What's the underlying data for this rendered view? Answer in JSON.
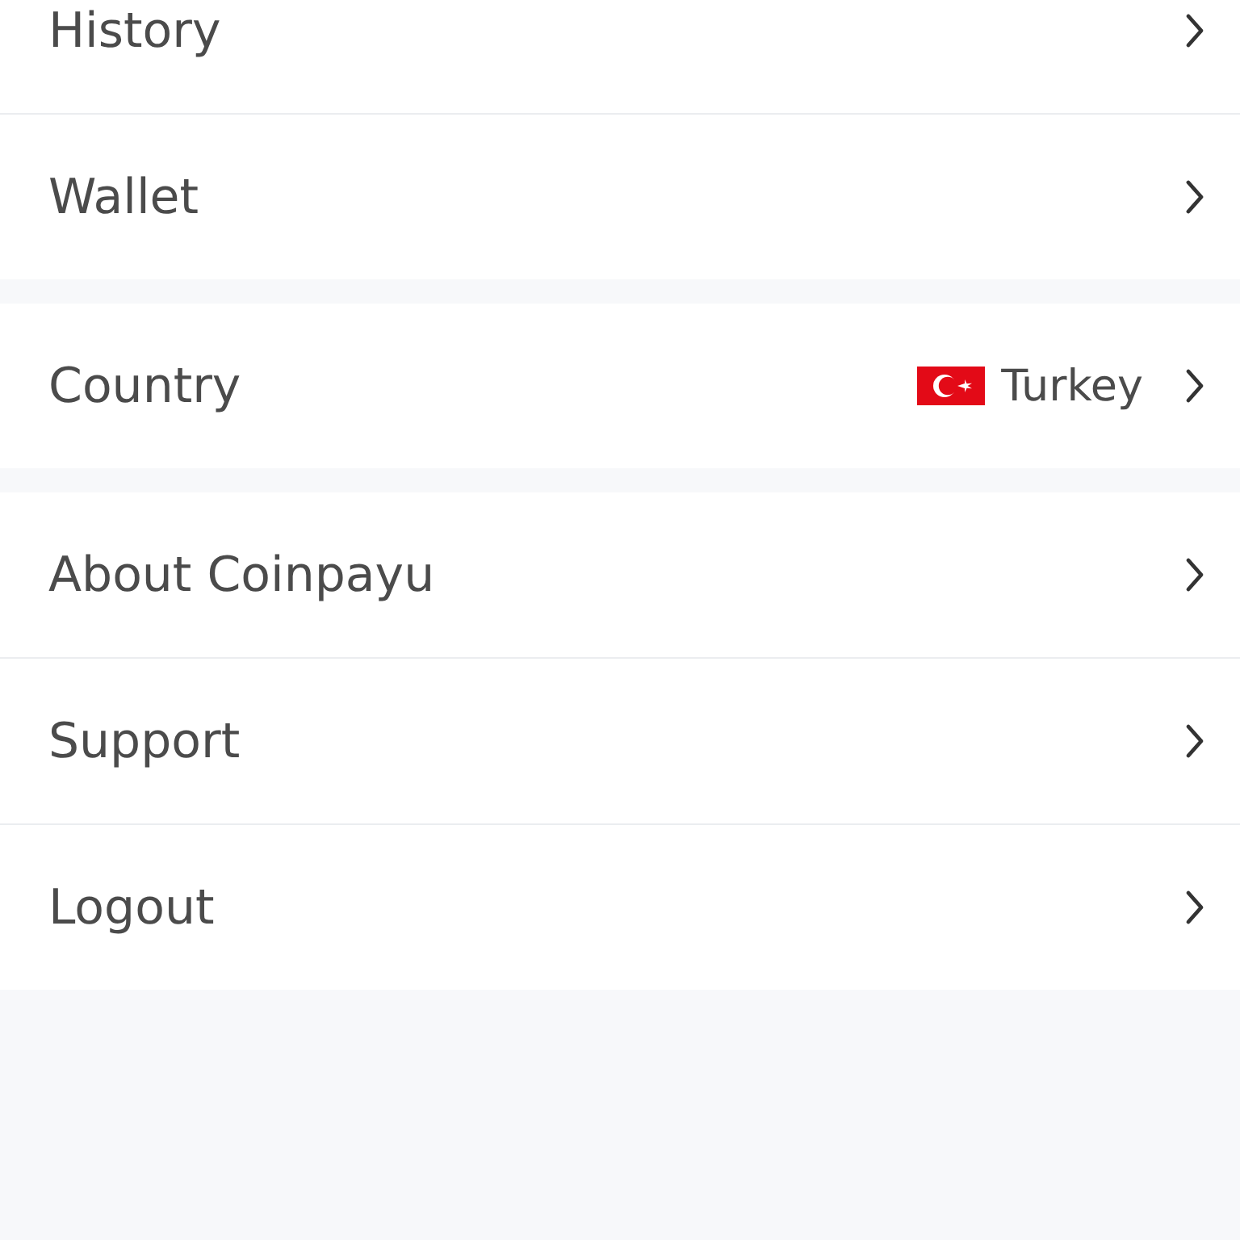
{
  "sections": [
    {
      "items": [
        {
          "label": "History"
        },
        {
          "label": "Wallet"
        }
      ]
    },
    {
      "items": [
        {
          "label": "Country",
          "value": "Turkey"
        }
      ]
    },
    {
      "items": [
        {
          "label": "About Coinpayu"
        },
        {
          "label": "Support"
        },
        {
          "label": "Logout"
        }
      ]
    }
  ]
}
